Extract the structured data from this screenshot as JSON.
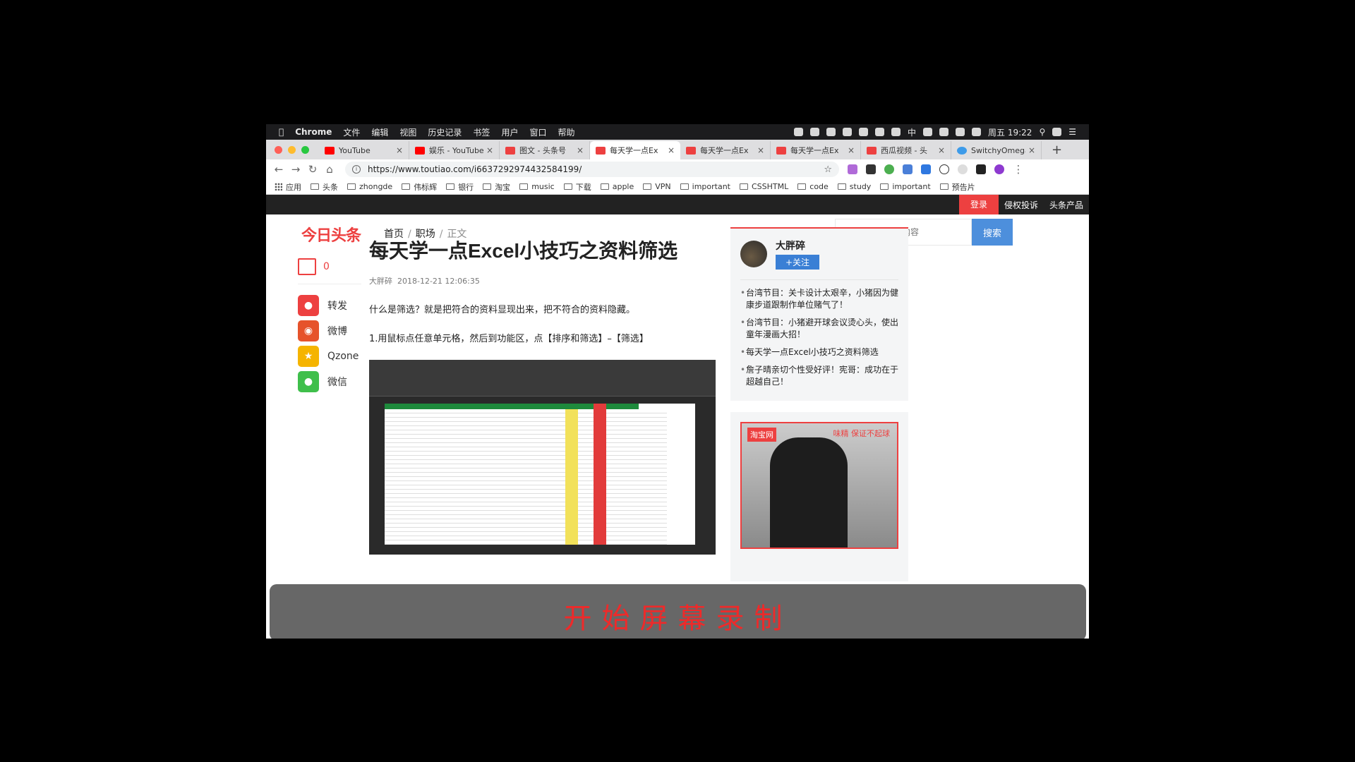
{
  "menubar": {
    "app": "Chrome",
    "items": [
      "文件",
      "编辑",
      "视图",
      "历史记录",
      "书签",
      "用户",
      "窗口",
      "帮助"
    ],
    "clock": "周五 19:22",
    "ime": "中"
  },
  "tabs": [
    {
      "title": "YouTube",
      "icon": "youtube-icon",
      "color": "#ff0000",
      "active": false
    },
    {
      "title": "娱乐 - YouTube",
      "icon": "youtube-icon",
      "color": "#ff0000",
      "active": false
    },
    {
      "title": "图文 - 头条号",
      "icon": "toutiao-icon",
      "color": "#ed4040",
      "active": false
    },
    {
      "title": "每天学一点Ex",
      "icon": "toutiao-icon",
      "color": "#ed4040",
      "active": true
    },
    {
      "title": "每天学一点Ex",
      "icon": "toutiao-icon",
      "color": "#ed4040",
      "active": false
    },
    {
      "title": "每天学一点Ex",
      "icon": "toutiao-icon",
      "color": "#ed4040",
      "active": false
    },
    {
      "title": "西瓜视频 - 头",
      "icon": "toutiao-icon",
      "color": "#ed4040",
      "active": false
    },
    {
      "title": "SwitchyOmega",
      "icon": "switchy-icon",
      "color": "#3d9be9",
      "active": false
    }
  ],
  "url": "https://www.toutiao.com/i6637292974432584199/",
  "bookmarks": [
    "应用",
    "头条",
    "zhongde",
    "伟标辉",
    "银行",
    "淘宝",
    "music",
    "下载",
    "apple",
    "VPN",
    "important",
    "CSSHTML",
    "code",
    "study",
    "important",
    "预告片"
  ],
  "site_top": {
    "login": "登录",
    "links": [
      "侵权投诉",
      "头条产品"
    ]
  },
  "header": {
    "logo": "今日头条",
    "breadcrumb": {
      "home": "首页",
      "section": "职场",
      "current": "正文"
    },
    "search_placeholder": "请输入要搜索的内容",
    "search_button": "搜索"
  },
  "sharebar": {
    "comment_count": "0",
    "items": [
      {
        "label": "转发",
        "color": "#ed4040",
        "icon": "repost-icon"
      },
      {
        "label": "微博",
        "color": "#e6532b",
        "icon": "weibo-icon"
      },
      {
        "label": "Qzone",
        "color": "#f5b400",
        "icon": "qzone-icon"
      },
      {
        "label": "微信",
        "color": "#3fbf4b",
        "icon": "wechat-icon"
      }
    ]
  },
  "article": {
    "title": "每天学一点Excel小技巧之资料筛选",
    "author": "大胖碎",
    "date": "2018-12-21 12:06:35",
    "para1": "什么是筛选？就是把符合的资料显现出来，把不符合的资料隐藏。",
    "para2": "1.用鼠标点任意单元格，然后到功能区，点【排序和筛选】–【筛选】"
  },
  "sidebar": {
    "author_name": "大胖碎",
    "follow": "+关注",
    "related": [
      "台湾节目：关卡设计太艰辛，小猪因为健康步道跟制作单位赌气了！",
      "台湾节目：小猪避开球会议烫心头，使出童年漫画大招！",
      "每天学一点Excel小技巧之资料筛选",
      "詹子晴亲切个性受好评！宪哥：成功在于超越自己！"
    ],
    "ad": {
      "brand": "淘宝网",
      "promo": "味精 保证不起球"
    }
  },
  "overlay_text": "开始屏幕录制"
}
